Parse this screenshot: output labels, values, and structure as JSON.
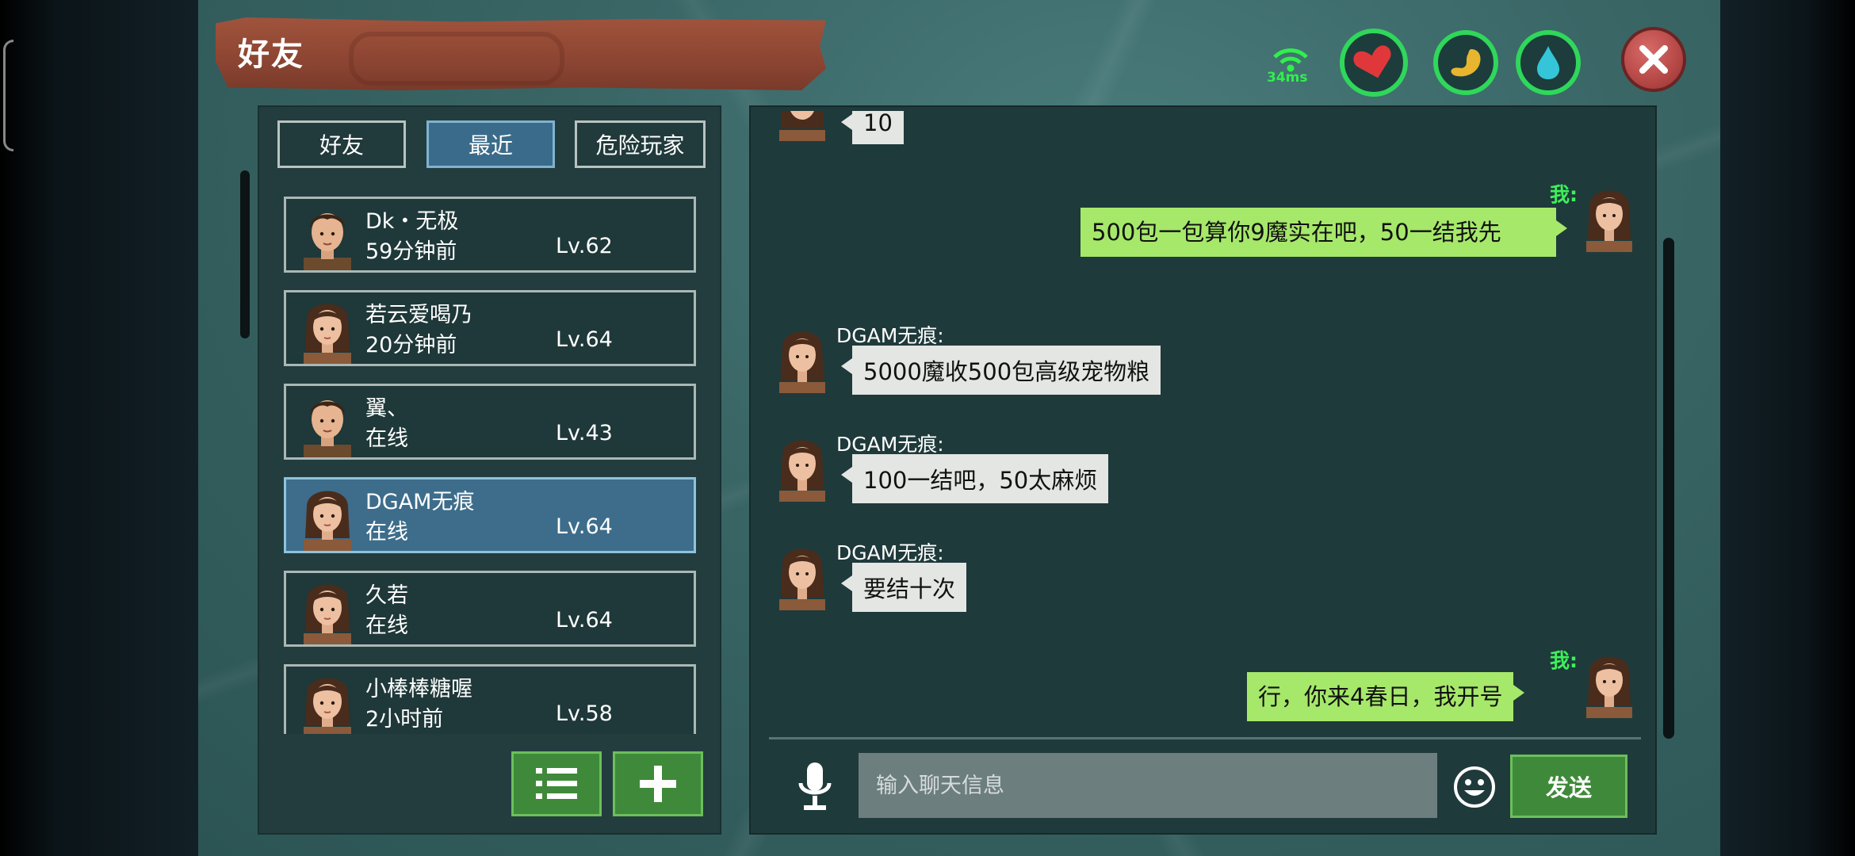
{
  "window": {
    "title": "好友"
  },
  "network": {
    "ping": "34ms"
  },
  "tabs": [
    {
      "label": "好友",
      "active": false
    },
    {
      "label": "最近",
      "active": true
    },
    {
      "label": "危险玩家",
      "active": false
    }
  ],
  "friends": [
    {
      "name": "Dk・无极",
      "status": "59分钟前",
      "level": "Lv.62",
      "gender": "male",
      "selected": false
    },
    {
      "name": "若云爱喝乃",
      "status": "20分钟前",
      "level": "Lv.64",
      "gender": "female",
      "selected": false
    },
    {
      "name": "翼、",
      "status": "在线",
      "level": "Lv.43",
      "gender": "male",
      "selected": false
    },
    {
      "name": "DGAM无痕",
      "status": "在线",
      "level": "Lv.64",
      "gender": "female",
      "selected": true
    },
    {
      "name": "久若",
      "status": "在线",
      "level": "Lv.64",
      "gender": "female",
      "selected": false
    },
    {
      "name": "小棒棒糖喔",
      "status": "2小时前",
      "level": "Lv.58",
      "gender": "female",
      "selected": false
    }
  ],
  "chat": {
    "partial_top": "10",
    "me_label": "我:",
    "messages": [
      {
        "from": "me",
        "text": "500包一包算你9魔实在吧，50一结我先"
      },
      {
        "from": "DGAM无痕:",
        "text": "5000魔收500包高级宠物粮"
      },
      {
        "from": "DGAM无痕:",
        "text": "100一结吧，50太麻烦"
      },
      {
        "from": "DGAM无痕:",
        "text": "要结十次"
      },
      {
        "from": "me",
        "text": "行，你来4春日，我开号"
      }
    ],
    "input_placeholder": "输入聊天信息",
    "send_label": "发送"
  },
  "colors": {
    "accent_green": "#3f8a3a",
    "selected_blue": "#3d6d8b",
    "me_bubble": "#a6e86a",
    "other_bubble": "#e4e6e4",
    "ping_green": "#2ff04a"
  },
  "icons": [
    "wifi-icon",
    "heart-icon",
    "stomach-icon",
    "water-drop-icon",
    "close-icon",
    "list-icon",
    "plus-icon",
    "microphone-icon",
    "emoji-icon"
  ]
}
